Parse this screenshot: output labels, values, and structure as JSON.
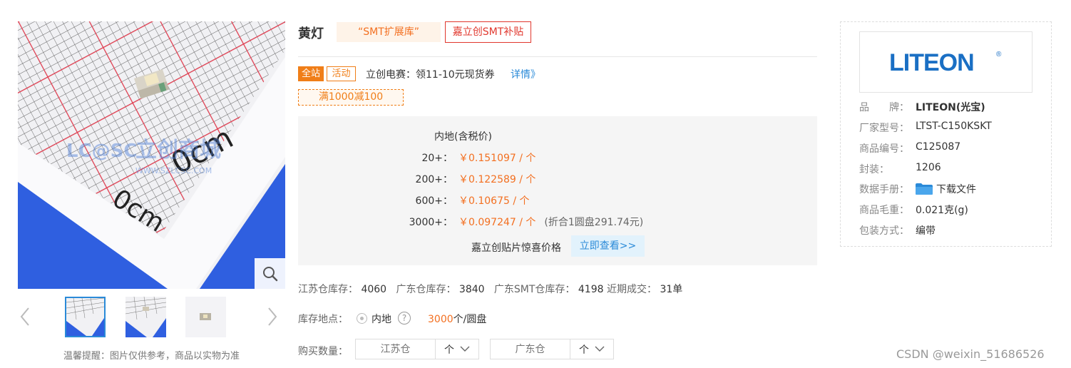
{
  "gallery": {
    "watermark_cn": "立创商城",
    "watermark_en": "WWW.SZLCSC.COM",
    "watermark_logo": "LC@SC",
    "ruler_text": "0cm",
    "tip": "温馨提醒：图片仅供参考，商品以实物为准"
  },
  "product": {
    "title": "黄灯",
    "tag_smt": "“SMT扩展库”",
    "tag_subsidy": "嘉立创SMT补贴"
  },
  "promo": {
    "badge_all": "全站",
    "badge_activity": "活动",
    "text": "立创电赛：领11-10元现货券",
    "link": "详情》",
    "coupon": "满1000减100"
  },
  "price": {
    "header": "内地(含税价)",
    "tiers": [
      {
        "qty": "20+：",
        "price": "￥0.151097 / 个",
        "note": ""
      },
      {
        "qty": "200+：",
        "price": "￥0.122589 / 个",
        "note": ""
      },
      {
        "qty": "600+：",
        "price": "￥0.10675 / 个",
        "note": ""
      },
      {
        "qty": "3000+：",
        "price": "￥0.097247 / 个",
        "note": "(折合1圆盘291.74元)"
      }
    ],
    "smt_text": "嘉立创贴片惊喜价格",
    "smt_button": "立即查看>>"
  },
  "stock": {
    "js_label": "江苏仓库存：",
    "js_value": "4060",
    "gd_label": "广东仓库存：",
    "gd_value": "3840",
    "gdsmt_label": "广东SMT仓库存：",
    "gdsmt_value": "4198",
    "recent_label": "近期成交：",
    "recent_value": "31单"
  },
  "location": {
    "label": "库存地点：",
    "option": "内地",
    "reel_num": "3000",
    "reel_unit": "个/圆盘"
  },
  "buy": {
    "label": "购买数量：",
    "js_placeholder": "江苏仓",
    "gd_placeholder": "广东仓",
    "unit": "个"
  },
  "brand": {
    "logo_text": "LITEON",
    "specs": [
      {
        "key": "品　　牌：",
        "value": "LITEON(光宝)",
        "bold": true
      },
      {
        "key": "厂家型号：",
        "value": "LTST-C150KSKT"
      },
      {
        "key": "商品编号：",
        "value": "C125087"
      },
      {
        "key": "封装：",
        "value": "1206"
      },
      {
        "key": "数据手册：",
        "value": "下载文件"
      },
      {
        "key": "商品毛重：",
        "value": "0.021克(g)"
      },
      {
        "key": "包装方式：",
        "value": "编带"
      }
    ]
  },
  "footer": {
    "watermark": "CSDN @weixin_51686526"
  },
  "colors": {
    "accent": "#f36f20",
    "link": "#2a8ad8",
    "subsidy": "#e1372d",
    "tape_blue": "#2f5fe0",
    "grid_red": "#e53b4e"
  }
}
